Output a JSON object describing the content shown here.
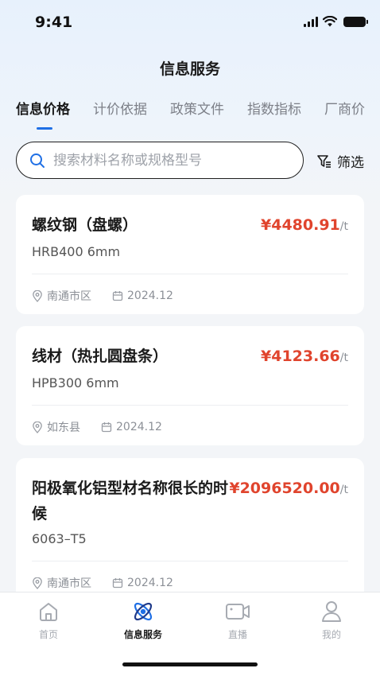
{
  "status_bar": {
    "time": "9:41"
  },
  "header": {
    "title": "信息服务"
  },
  "tabs": [
    {
      "label": "信息价格",
      "active": true
    },
    {
      "label": "计价依据",
      "active": false
    },
    {
      "label": "政策文件",
      "active": false
    },
    {
      "label": "指数指标",
      "active": false
    },
    {
      "label": "厂商价",
      "active": false
    }
  ],
  "search": {
    "placeholder": "搜索材料名称或规格型号",
    "value": ""
  },
  "filter": {
    "label": "筛选"
  },
  "items": [
    {
      "name": "螺纹钢（盘螺）",
      "price": "¥4480.91",
      "unit": "/t",
      "spec": "HRB400 6mm",
      "region": "南通市区",
      "date": "2024.12"
    },
    {
      "name": "线材（热扎圆盘条）",
      "price": "¥4123.66",
      "unit": "/t",
      "spec": "HPB300 6mm",
      "region": "如东县",
      "date": "2024.12"
    },
    {
      "name": "阳极氧化铝型材名称很长的时候",
      "price": "¥2096520.00",
      "unit": "/t",
      "spec": "6063–T5",
      "region": "南通市区",
      "date": "2024.12"
    }
  ],
  "tabbar": [
    {
      "label": "首页",
      "icon": "home-icon",
      "active": false
    },
    {
      "label": "信息服务",
      "icon": "atom-icon",
      "active": true
    },
    {
      "label": "直播",
      "icon": "video-icon",
      "active": false
    },
    {
      "label": "我的",
      "icon": "user-icon",
      "active": false
    }
  ],
  "colors": {
    "accent": "#1f6fe5",
    "price": "#e0442d"
  }
}
